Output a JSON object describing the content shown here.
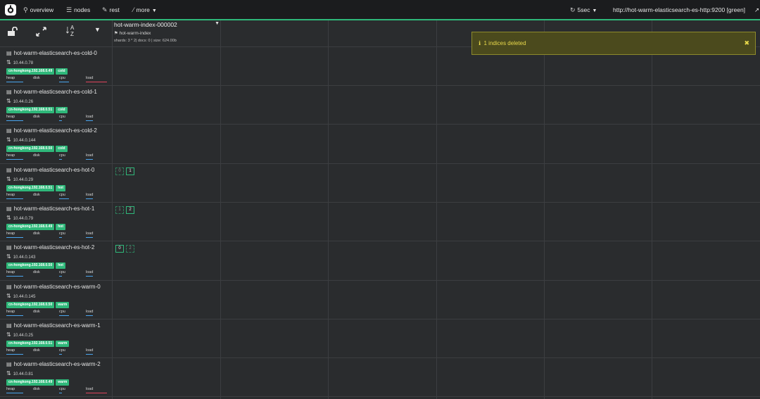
{
  "navbar": {
    "logo_icon": "cerebro-logo",
    "overview": "overview",
    "nodes": "nodes",
    "rest": "rest",
    "more": "more",
    "refresh": "5sec",
    "cluster": "http://hot-warm-elasticsearch-es-http:9200 [green]"
  },
  "toolbar": {
    "lock_icon": "unlock-icon",
    "expand_icon": "expand-icon",
    "sort_a": "A",
    "sort_z": "Z",
    "filter_icon": "caret-down-icon"
  },
  "index": {
    "name": "hot-warm-index-000002",
    "alias": "hot-warm-index",
    "meta": "shards: 3 * 2| docs: 0 | size: 624.00b"
  },
  "alert": {
    "message": "1 indices deleted",
    "colors": {
      "background": "#4b4a1d",
      "text": "#e9d94b"
    }
  },
  "metric_labels": {
    "heap": "heap",
    "disk": "disk",
    "cpu": "cpu",
    "load": "load"
  },
  "colors": {
    "accent": "#2fb87a",
    "bar_blue": "#4aa6f0",
    "bar_red": "#e0455d"
  },
  "nodes": [
    {
      "name": "hot-warm-elasticsearch-es-cold-0",
      "ip": "10.44.0.78",
      "zone": "cn-hongkong.192.168.0.49",
      "tier": "cold"
    },
    {
      "name": "hot-warm-elasticsearch-es-cold-1",
      "ip": "10.44.0.26",
      "zone": "cn-hongkong.192.168.0.51",
      "tier": "cold"
    },
    {
      "name": "hot-warm-elasticsearch-es-cold-2",
      "ip": "10.44.0.144",
      "zone": "cn-hongkong.192.168.0.50",
      "tier": "cold"
    },
    {
      "name": "hot-warm-elasticsearch-es-hot-0",
      "ip": "10.44.0.29",
      "zone": "cn-hongkong.192.168.0.51",
      "tier": "hot",
      "shards": [
        {
          "num": "0",
          "primary": false
        },
        {
          "num": "1",
          "primary": true
        }
      ]
    },
    {
      "name": "hot-warm-elasticsearch-es-hot-1",
      "ip": "10.44.0.79",
      "zone": "cn-hongkong.192.168.0.49",
      "tier": "hot",
      "shards": [
        {
          "num": "1",
          "primary": false
        },
        {
          "num": "2",
          "primary": true
        }
      ]
    },
    {
      "name": "hot-warm-elasticsearch-es-hot-2",
      "ip": "10.44.0.143",
      "zone": "cn-hongkong.192.168.0.50",
      "tier": "hot",
      "shards": [
        {
          "num": "0",
          "primary": true
        },
        {
          "num": "2",
          "primary": false
        }
      ]
    },
    {
      "name": "hot-warm-elasticsearch-es-warm-0",
      "ip": "10.44.0.145",
      "zone": "cn-hongkong.192.168.0.50",
      "tier": "warm"
    },
    {
      "name": "hot-warm-elasticsearch-es-warm-1",
      "ip": "10.44.0.25",
      "zone": "cn-hongkong.192.168.0.51",
      "tier": "warm"
    },
    {
      "name": "hot-warm-elasticsearch-es-warm-2",
      "ip": "10.44.0.81",
      "zone": "cn-hongkong.192.168.0.49",
      "tier": "warm"
    }
  ]
}
